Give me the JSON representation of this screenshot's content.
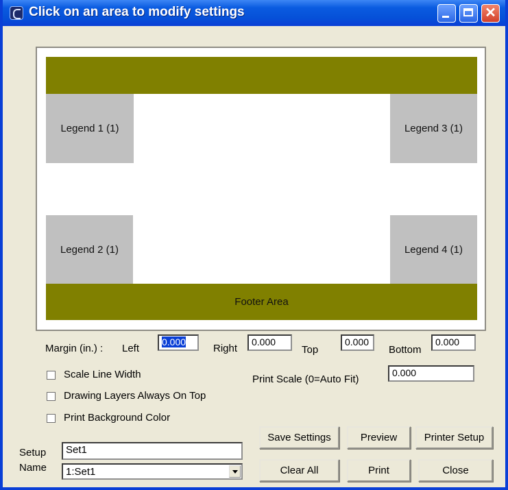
{
  "window": {
    "title": "Click on an area to modify settings"
  },
  "layout_preview": {
    "footer_label": "Footer Area",
    "legends": [
      "Legend 1 (1)",
      "Legend 2 (1)",
      "Legend 3 (1)",
      "Legend 4 (1)"
    ],
    "header_color": "#808000",
    "legend_color": "#c0c0c0"
  },
  "margins": {
    "label": "Margin (in.) :",
    "left_label": "Left",
    "left_value": "0.000",
    "right_label": "Right",
    "right_value": "0.000",
    "top_label": "Top",
    "top_value": "0.000",
    "bottom_label": "Bottom",
    "bottom_value": "0.000"
  },
  "options": {
    "scale_line_width": {
      "label": "Scale Line Width",
      "checked": false
    },
    "drawing_layers_on_top": {
      "label": "Drawing Layers Always On Top",
      "checked": false
    },
    "print_background_color": {
      "label": "Print Background Color",
      "checked": false
    }
  },
  "print_scale": {
    "label": "Print Scale (0=Auto Fit)",
    "value": "0.000"
  },
  "setup": {
    "label_line1": "Setup",
    "label_line2": "Name",
    "name_value": "Set1",
    "selected": "1:Set1"
  },
  "buttons": {
    "save_settings": "Save Settings",
    "preview": "Preview",
    "printer_setup": "Printer Setup",
    "clear_all": "Clear All",
    "print": "Print",
    "close": "Close"
  }
}
